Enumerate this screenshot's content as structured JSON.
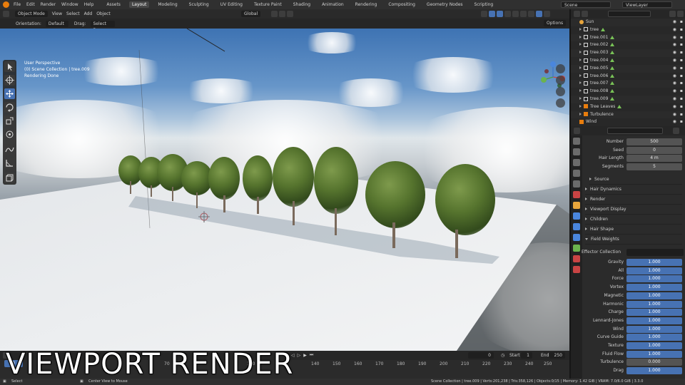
{
  "menu": {
    "items": [
      "File",
      "Edit",
      "Render",
      "Window",
      "Help"
    ],
    "workspaces": [
      "Assets",
      "Layout",
      "Modeling",
      "Sculpting",
      "UV Editing",
      "Texture Paint",
      "Shading",
      "Animation",
      "Rendering",
      "Compositing",
      "Geometry Nodes",
      "Scripting"
    ],
    "active_workspace": "Layout",
    "scene": "Scene",
    "view_layer": "ViewLayer"
  },
  "viewport_header": {
    "mode": "Object Mode",
    "menus": [
      "View",
      "Select",
      "Add",
      "Object"
    ],
    "orientation": "Global"
  },
  "tool_settings": {
    "orientation_label": "Orientation:",
    "orientation_value": "Default",
    "drag_label": "Drag:",
    "drag_value": "Select Box",
    "options": "Options"
  },
  "viewport": {
    "line1": "User Perspective",
    "line2": "(0) Scene Collection | tree.009",
    "line3": "Rendering Done"
  },
  "outliner": {
    "rows": [
      {
        "label": "Sun",
        "icon_color": "#e8a53c"
      },
      {
        "label": "tree",
        "icon_color": "#d8d8d8"
      },
      {
        "label": "tree.001",
        "icon_color": "#d8d8d8"
      },
      {
        "label": "tree.002",
        "icon_color": "#d8d8d8"
      },
      {
        "label": "tree.003",
        "icon_color": "#d8d8d8"
      },
      {
        "label": "tree.004",
        "icon_color": "#d8d8d8"
      },
      {
        "label": "tree.005",
        "icon_color": "#d8d8d8"
      },
      {
        "label": "tree.006",
        "icon_color": "#d8d8d8"
      },
      {
        "label": "tree.007",
        "icon_color": "#d8d8d8"
      },
      {
        "label": "tree.008",
        "icon_color": "#d8d8d8"
      },
      {
        "label": "tree.009",
        "icon_color": "#d8d8d8"
      },
      {
        "label": "Tree Leaves",
        "icon_color": "#e87d0d"
      },
      {
        "label": "Turbulence",
        "icon_color": "#e87d0d"
      },
      {
        "label": "Wind",
        "icon_color": "#e87d0d"
      }
    ]
  },
  "properties": {
    "fields": [
      {
        "label": "Number",
        "value": "500"
      },
      {
        "label": "Seed",
        "value": "0"
      },
      {
        "label": "Hair Length",
        "value": "4 m"
      },
      {
        "label": "Segments",
        "value": "5"
      }
    ],
    "sections": [
      "Source",
      "Hair Dynamics",
      "Render",
      "Viewport Display",
      "Children",
      "Hair Shape",
      "Field Weights"
    ],
    "effector_label": "Effector Collection",
    "weights": [
      {
        "label": "Gravity",
        "value": "1.000"
      },
      {
        "label": "All",
        "value": "1.000"
      },
      {
        "label": "Force",
        "value": "1.000"
      },
      {
        "label": "Vortex",
        "value": "1.000"
      },
      {
        "label": "Magnetic",
        "value": "1.000"
      },
      {
        "label": "Harmonic",
        "value": "1.000"
      },
      {
        "label": "Charge",
        "value": "1.000"
      },
      {
        "label": "Lennard-Jones",
        "value": "1.000"
      },
      {
        "label": "Wind",
        "value": "1.000"
      },
      {
        "label": "Curve Guide",
        "value": "1.000"
      },
      {
        "label": "Texture",
        "value": "1.000"
      },
      {
        "label": "Fluid Flow",
        "value": "1.000"
      },
      {
        "label": "Turbulence",
        "value": "0.000"
      },
      {
        "label": "Drag",
        "value": "1.000"
      }
    ]
  },
  "timeline": {
    "current_frame": "0",
    "start_label": "Start",
    "start": "1",
    "end_label": "End",
    "end": "250",
    "ticks": [
      "70",
      "110",
      "140",
      "150",
      "160",
      "170",
      "180",
      "190",
      "200",
      "210",
      "220",
      "230",
      "240",
      "250"
    ],
    "playhead": "0"
  },
  "banner": "VIEWPORT RENDER",
  "status": {
    "left": "Select",
    "middle": "Center View to Mouse",
    "right": "Scene Collection | tree.009 | Verts:201,238 | Tris:358,126 | Objects:0/15 | Memory: 1.42 GiB | VRAM: 7.0/6.0 GiB | 3.3.0"
  }
}
